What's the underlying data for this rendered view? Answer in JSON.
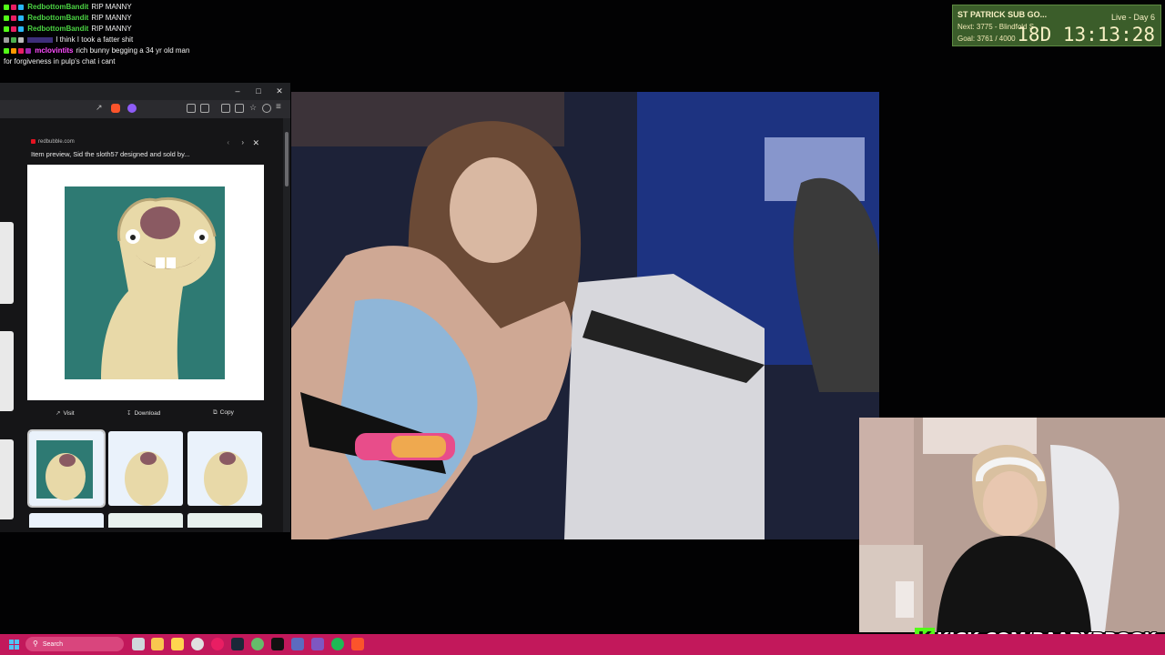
{
  "chat": {
    "messages": [
      {
        "user": "RedbottomBandit",
        "user_color": "#4bd443",
        "text": "RIP MANNY"
      },
      {
        "user": "RedbottomBandit",
        "user_color": "#4bd443",
        "text": "RIP MANNY"
      },
      {
        "user": "RedbottomBandit",
        "user_color": "#4bd443",
        "text": "RIP MANNY"
      },
      {
        "user": "",
        "user_color": "#7b5cff",
        "text": "I think I took a fatter shit"
      },
      {
        "user": "mclovintits",
        "user_color": "#ff4cff",
        "text": "rich bunny begging a 34 yr old man for forgiveness in pulp's chat i cant"
      }
    ]
  },
  "subgoal": {
    "title": "ST PATRICK SUB GO...",
    "live": "Live - Day 6",
    "next": "Next: 3775 - Blindfold S",
    "goal": "Goal: 3761 / 4000",
    "timer": "18D  13:13:28"
  },
  "browser": {
    "preview": {
      "source": "redbubble.com",
      "title": "Item preview, Sid the sloth57 designed and sold by...",
      "actions": {
        "visit": "Visit",
        "download": "Download",
        "copy": "Copy"
      }
    }
  },
  "stream": {
    "kick_url": "KICK.COM/BAABYBROOK"
  },
  "taskbar": {
    "search_placeholder": "Search"
  },
  "colors": {
    "taskbar": "#c2185b",
    "kick_green": "#53fc18",
    "subgoal_bg": "#3b5d2a"
  }
}
